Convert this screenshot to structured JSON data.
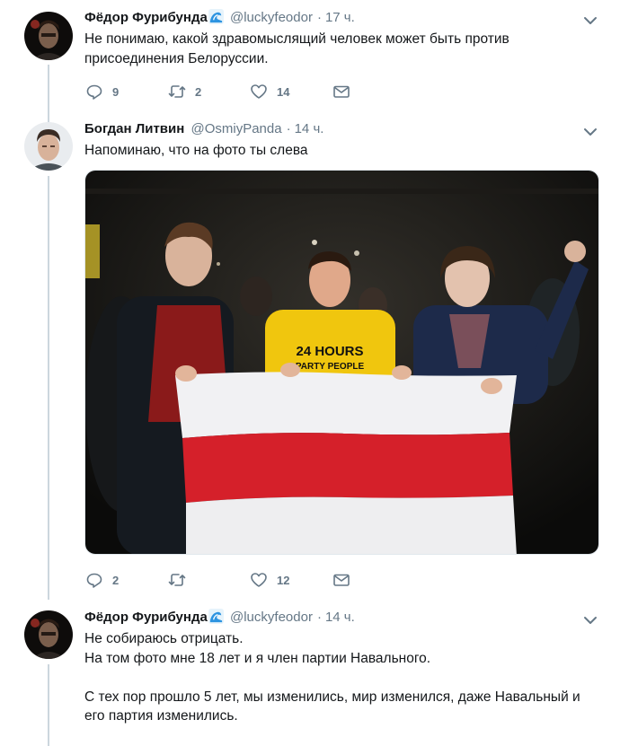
{
  "tweets": [
    {
      "name": "Фёдор Фурибунда",
      "handle": "@luckyfeodor",
      "separator": "·",
      "time": "17 ч.",
      "lines": [
        "Не понимаю, какой здравомыслящий человек может быть против",
        "присоединения Белоруссии."
      ],
      "replies": "9",
      "retweets": "2",
      "likes": "14",
      "name_emoji_icon": "wave-icon"
    },
    {
      "name": "Богдан Литвин",
      "handle": "@OsmiyPanda",
      "separator": "·",
      "time": "14 ч.",
      "lines": [
        "Напоминаю, что на фото ты слева"
      ],
      "media": {
        "shirt_text_1": "24 HOURS",
        "shirt_text_2": "PARTY PEOPLE"
      },
      "replies": "2",
      "retweets": "",
      "likes": "12"
    },
    {
      "name": "Фёдор Фурибунда",
      "handle": "@luckyfeodor",
      "separator": "·",
      "time": "14 ч.",
      "lines": [
        "Не собираюсь отрицать.",
        "На том фото мне 18 лет и я член партии Навального.",
        "",
        "С тех пор прошло 5 лет, мы изменились, мир изменился, даже Навальный и",
        "его партия изменились."
      ],
      "name_emoji_icon": "wave-icon"
    }
  ],
  "colors": {
    "text": "#14171a",
    "secondary": "#657786",
    "thread_line": "#ccd6dd",
    "flag_white": "#f2f2f4",
    "flag_red": "#d5202a"
  }
}
